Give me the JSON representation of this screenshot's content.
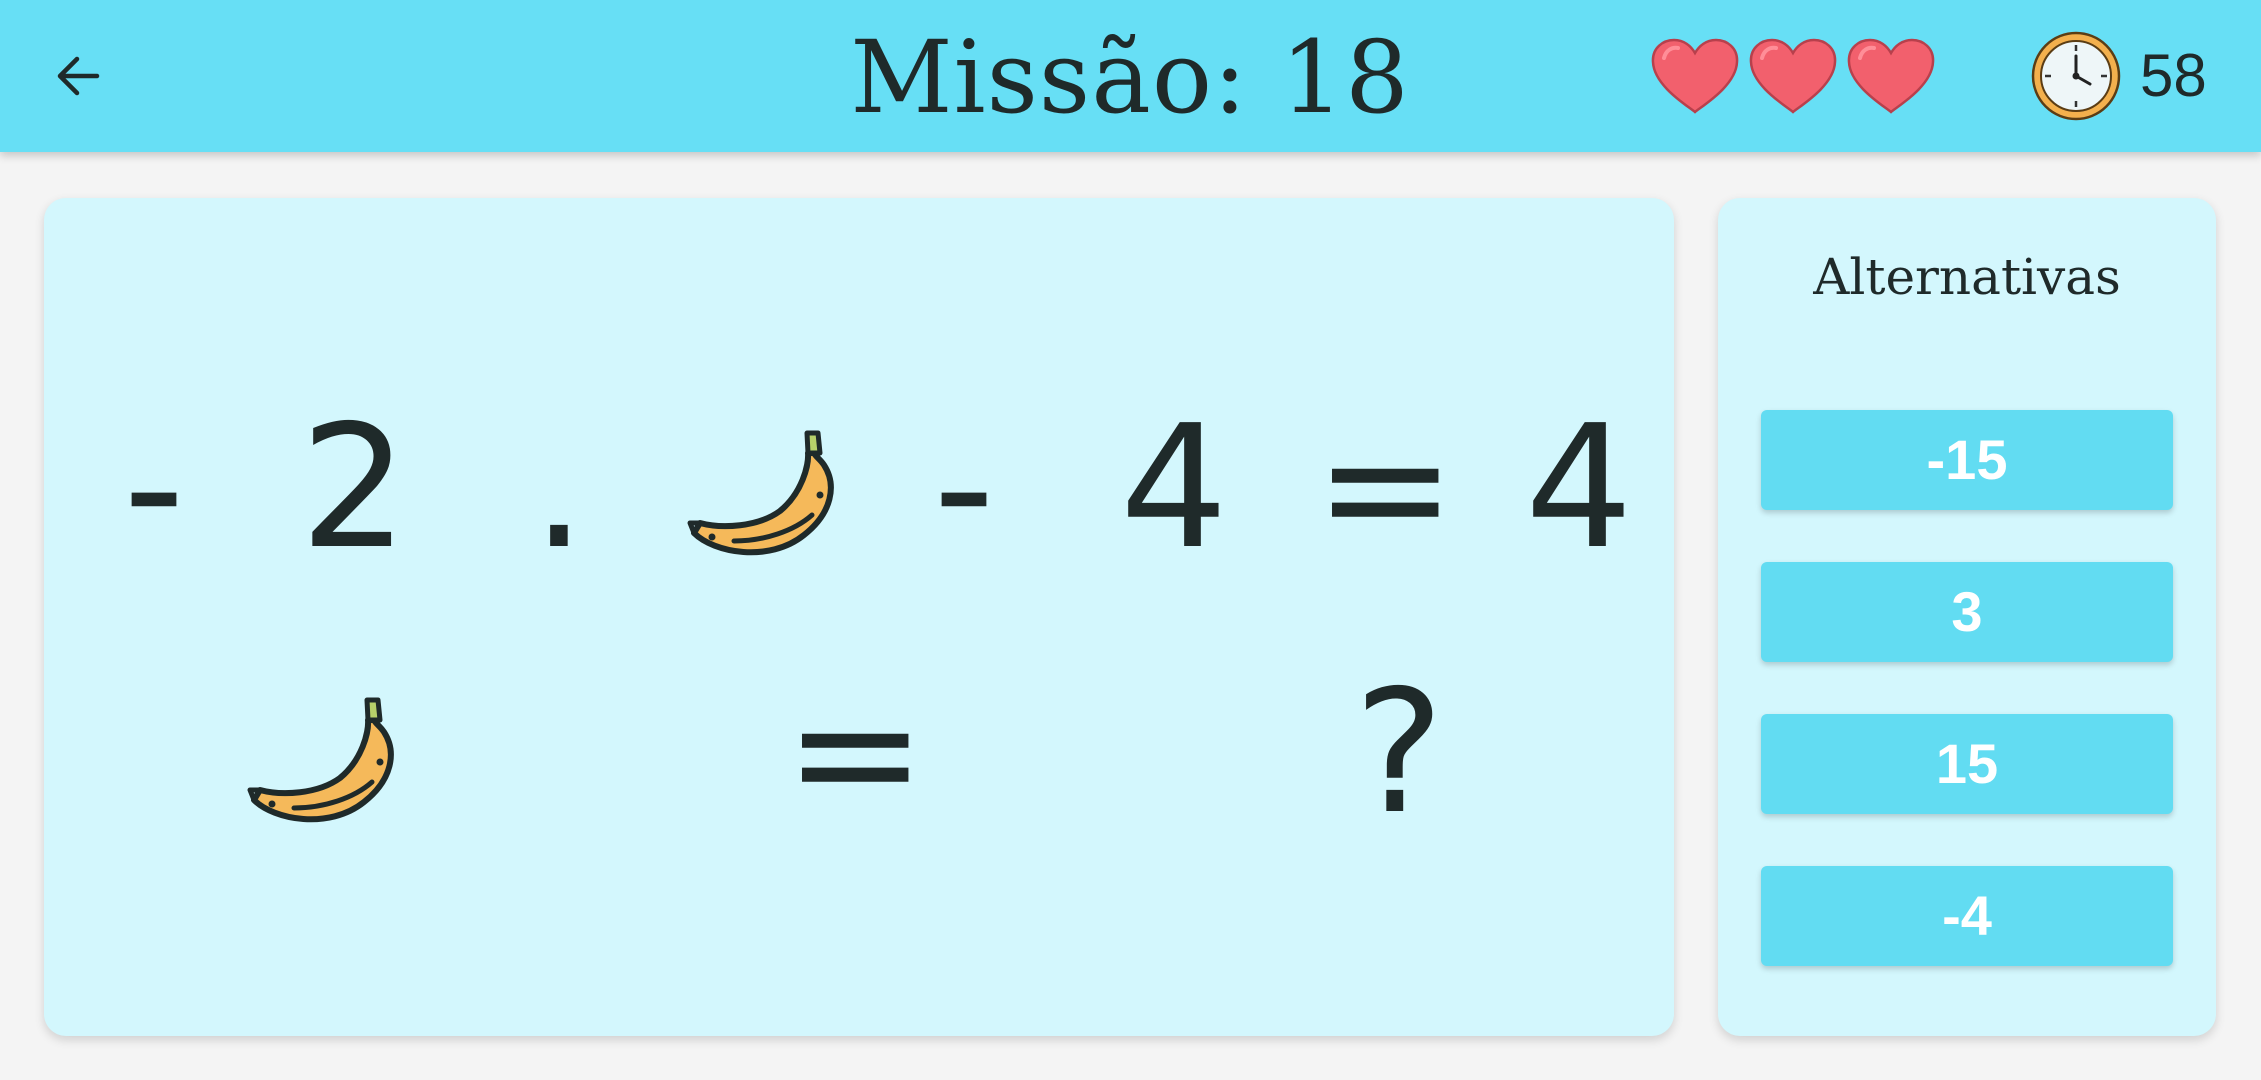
{
  "header": {
    "title": "Missão: 18",
    "lives": 3,
    "timer": "58",
    "back_icon": "arrow-left-icon",
    "heart_icon": "heart-icon",
    "timer_icon": "clock-icon"
  },
  "question": {
    "row1": [
      "-",
      "2",
      ".",
      "banana",
      "-",
      "4",
      "=",
      "4"
    ],
    "row2": [
      "banana",
      "=",
      "?"
    ],
    "tokens": {
      "minus1": "-",
      "two": "2",
      "dot": ".",
      "minus2": "-",
      "four1": "4",
      "equals1": "=",
      "four2": "4",
      "equals2": "=",
      "question_mark": "?"
    },
    "symbol_icon": "banana-icon"
  },
  "alternatives": {
    "title": "Alternativas",
    "options": [
      "-15",
      "3",
      "15",
      "-4"
    ]
  },
  "colors": {
    "header_bg": "#67dff5",
    "panel_bg": "#d3f7fd",
    "button_bg": "#62dcf2",
    "heart": "#f2606d",
    "banana": "#f5b95a",
    "ink": "#1f2a2a"
  }
}
